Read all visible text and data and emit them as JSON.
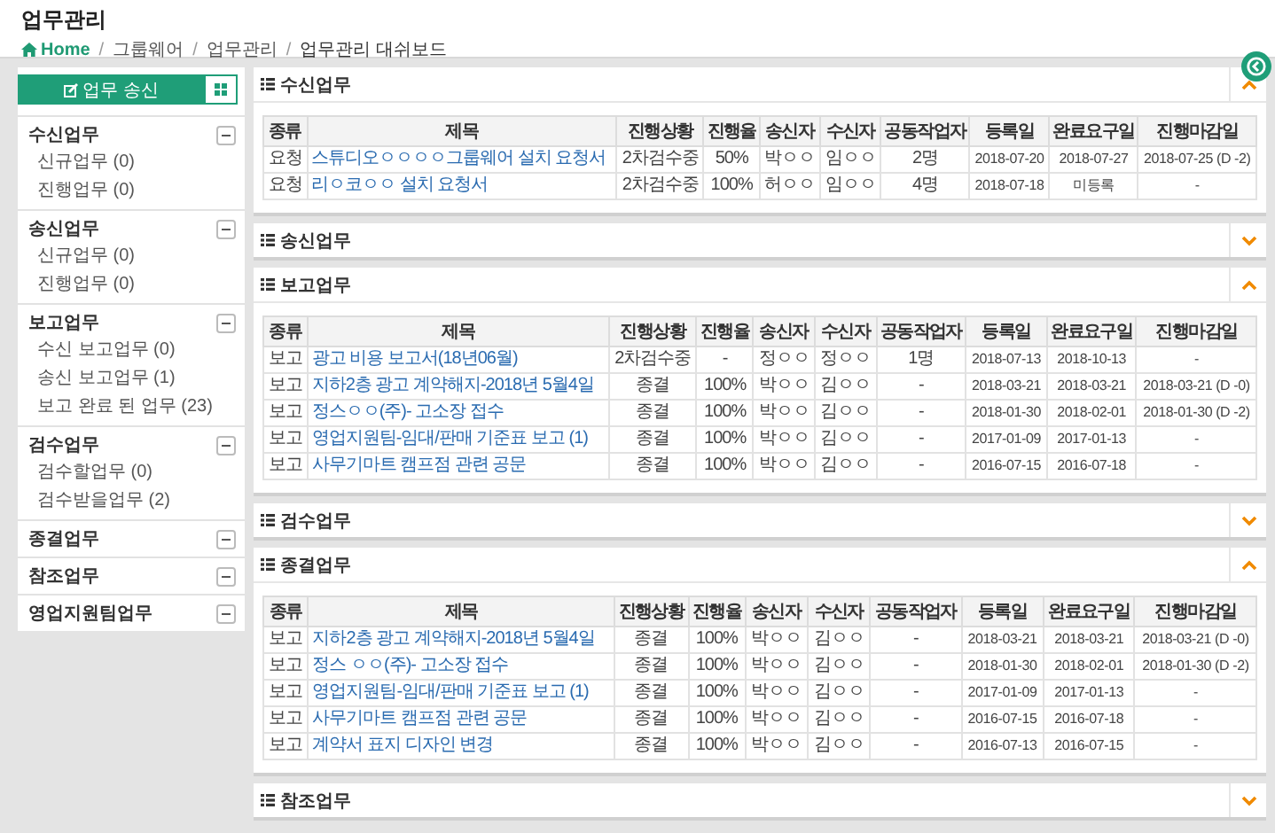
{
  "page": {
    "title": "업무관리",
    "breadcrumb": {
      "home": "Home",
      "separator": "/",
      "items": [
        "그룹웨어",
        "업무관리",
        "업무관리 대쉬보드"
      ]
    }
  },
  "sidebar": {
    "send_button": "업무 송신",
    "groups": [
      {
        "title": "수신업무",
        "items": [
          "신규업무 (0)",
          "진행업무 (0)"
        ]
      },
      {
        "title": "송신업무",
        "items": [
          "신규업무 (0)",
          "진행업무 (0)"
        ]
      },
      {
        "title": "보고업무",
        "items": [
          "수신 보고업무 (0)",
          "송신 보고업무 (1)",
          "보고 완료 된 업무 (23)"
        ]
      },
      {
        "title": "검수업무",
        "items": [
          "검수할업무 (0)",
          "검수받을업무 (2)"
        ]
      },
      {
        "title": "종결업무"
      },
      {
        "title": "참조업무"
      },
      {
        "title": "영업지원팀업무"
      }
    ]
  },
  "panels": [
    {
      "title": "수신업무",
      "expanded": true,
      "columns": [
        "종류",
        "제목",
        "진행상황",
        "진행율",
        "송신자",
        "수신자",
        "공동작업자",
        "등록일",
        "완료요구일",
        "진행마감일"
      ],
      "rows": [
        [
          "요청",
          "스튜디오ㅇㅇㅇㅇ그룹웨어 설치 요청서",
          "2차검수중",
          "50%",
          "박ㅇㅇ",
          "임ㅇㅇ",
          "2명",
          "2018-07-20",
          "2018-07-27",
          "2018-07-25 (D -2)"
        ],
        [
          "요청",
          "리ㅇ코ㅇㅇ 설치 요청서",
          "2차검수중",
          "100%",
          "허ㅇㅇ",
          "임ㅇㅇ",
          "4명",
          "2018-07-18",
          "미등록",
          "-"
        ]
      ]
    },
    {
      "title": "송신업무",
      "expanded": false
    },
    {
      "title": "보고업무",
      "expanded": true,
      "columns": [
        "종류",
        "제목",
        "진행상황",
        "진행율",
        "송신자",
        "수신자",
        "공동작업자",
        "등록일",
        "완료요구일",
        "진행마감일"
      ],
      "rows": [
        [
          "보고",
          "광고 비용 보고서(18년06월)",
          "2차검수중",
          "-",
          "정ㅇㅇ",
          "정ㅇㅇ",
          "1명",
          "2018-07-13",
          "2018-10-13",
          "-"
        ],
        [
          "보고",
          "지하2층 광고 계약해지-2018년 5월4일",
          "종결",
          "100%",
          "박ㅇㅇ",
          "김ㅇㅇ",
          "-",
          "2018-03-21",
          "2018-03-21",
          "2018-03-21 (D -0)"
        ],
        [
          "보고",
          "정스ㅇㅇ(주)- 고소장 접수",
          "종결",
          "100%",
          "박ㅇㅇ",
          "김ㅇㅇ",
          "-",
          "2018-01-30",
          "2018-02-01",
          "2018-01-30 (D -2)"
        ],
        [
          "보고",
          "영업지원팀-임대/판매 기준표 보고 (1)",
          "종결",
          "100%",
          "박ㅇㅇ",
          "김ㅇㅇ",
          "-",
          "2017-01-09",
          "2017-01-13",
          "-"
        ],
        [
          "보고",
          "사무기마트 캠프점 관련 공문",
          "종결",
          "100%",
          "박ㅇㅇ",
          "김ㅇㅇ",
          "-",
          "2016-07-15",
          "2016-07-18",
          "-"
        ]
      ]
    },
    {
      "title": "검수업무",
      "expanded": false
    },
    {
      "title": "종결업무",
      "expanded": true,
      "columns": [
        "종류",
        "제목",
        "진행상황",
        "진행율",
        "송신자",
        "수신자",
        "공동작업자",
        "등록일",
        "완료요구일",
        "진행마감일"
      ],
      "rows": [
        [
          "보고",
          "지하2층 광고 계약해지-2018년 5월4일",
          "종결",
          "100%",
          "박ㅇㅇ",
          "김ㅇㅇ",
          "-",
          "2018-03-21",
          "2018-03-21",
          "2018-03-21 (D -0)"
        ],
        [
          "보고",
          "정스 ㅇㅇ(주)- 고소장 접수",
          "종결",
          "100%",
          "박ㅇㅇ",
          "김ㅇㅇ",
          "-",
          "2018-01-30",
          "2018-02-01",
          "2018-01-30 (D -2)"
        ],
        [
          "보고",
          "영업지원팀-임대/판매 기준표 보고 (1)",
          "종결",
          "100%",
          "박ㅇㅇ",
          "김ㅇㅇ",
          "-",
          "2017-01-09",
          "2017-01-13",
          "-"
        ],
        [
          "보고",
          "사무기마트 캠프점 관련 공문",
          "종결",
          "100%",
          "박ㅇㅇ",
          "김ㅇㅇ",
          "-",
          "2016-07-15",
          "2016-07-18",
          "-"
        ],
        [
          "보고",
          "계약서 표지 디자인 변경",
          "종결",
          "100%",
          "박ㅇㅇ",
          "김ㅇㅇ",
          "-",
          "2016-07-13",
          "2016-07-15",
          "-"
        ]
      ]
    },
    {
      "title": "참조업무",
      "expanded": false
    }
  ]
}
